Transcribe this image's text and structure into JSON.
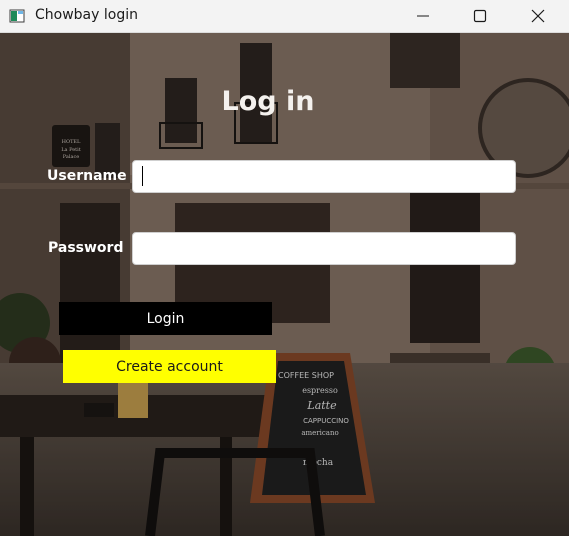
{
  "window": {
    "title": "Chowbay login",
    "icon": "app-window-icon",
    "controls": [
      "minimize-icon",
      "maximize-icon",
      "close-icon"
    ]
  },
  "background": {
    "hotel_sign": "HOTEL La Petit Palace",
    "board_lines": [
      "COFFEE SHOP",
      "espresso",
      "Latte",
      "CAPPUCCINO",
      "americano",
      "mocha"
    ]
  },
  "form": {
    "heading": "Log in",
    "username_label": "Username",
    "username_value": "",
    "password_label": "Password",
    "password_value": "",
    "login_button": "Login",
    "create_account_button": "Create account"
  },
  "colors": {
    "login_button_bg": "#000000",
    "create_button_bg": "#ffff00"
  }
}
